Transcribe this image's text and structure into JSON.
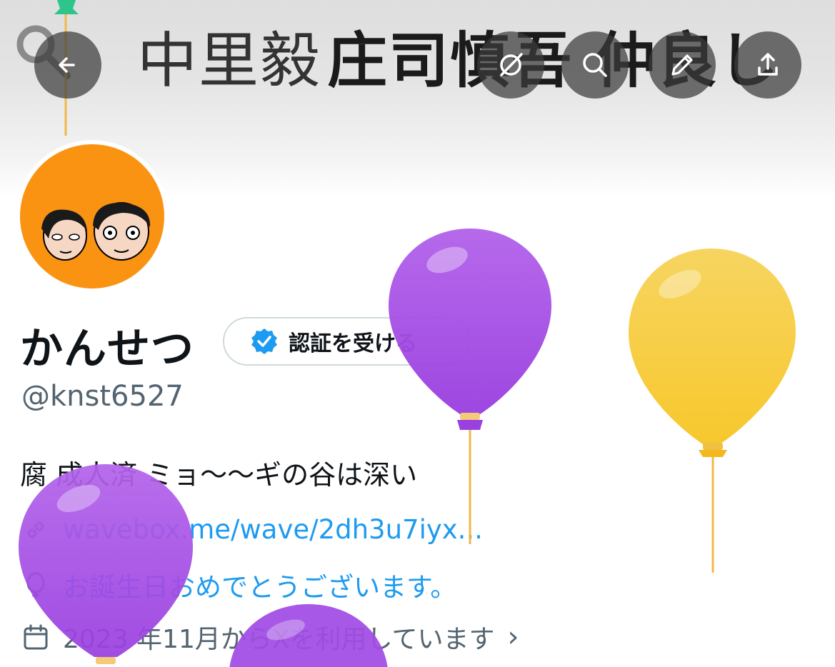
{
  "banner": {
    "text_left": "中里毅",
    "text_right": "庄司慎吾 仲良し"
  },
  "header_buttons": {
    "back": "back-arrow-icon",
    "grok": "grok-icon",
    "search": "search-icon",
    "edit": "pencil-icon",
    "share": "share-icon"
  },
  "profile": {
    "display_name": "かんせつ",
    "verify_button_label": "認証を受ける",
    "handle": "@knst6527",
    "bio": "腐 成人済 ミョ〜〜ギの谷は深い",
    "link_text": "wavebox.me/wave/2dh3u7iyx...",
    "birthday_text": "お誕生日おめでとうございます。",
    "joined_text": "2023 年11月からXを利用しています",
    "joined_chevron": "›"
  },
  "colors": {
    "link": "#1d9bf0",
    "verified_badge": "#1d9bf0",
    "avatar_bg": "#fb9312",
    "balloon_purple": "#a24de6",
    "balloon_yellow": "#f7cf3a"
  }
}
